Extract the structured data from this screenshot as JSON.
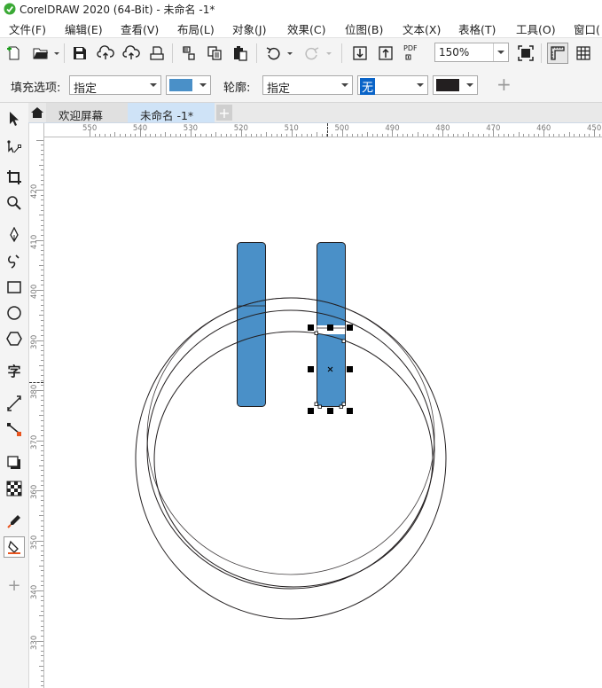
{
  "window": {
    "title": "CorelDRAW 2020 (64-Bit) - 未命名 -1*"
  },
  "menu": [
    "文件(F)",
    "编辑(E)",
    "查看(V)",
    "布局(L)",
    "对象(J)",
    "效果(C)",
    "位图(B)",
    "文本(X)",
    "表格(T)",
    "工具(O)",
    "窗口("
  ],
  "toolbar": {
    "zoom": "150%",
    "pdf_label": "PDF"
  },
  "property_bar": {
    "fill_label": "填充选项:",
    "fill_mode": "指定",
    "fill_color": "#4A90C8",
    "outline_label": "轮廓:",
    "outline_mode": "指定",
    "outline_width": "无",
    "outline_color": "#231F20",
    "add_symbol": "+"
  },
  "tabs": {
    "welcome": "欢迎屏幕",
    "document": "未命名 -1*",
    "add": "+"
  },
  "rulers": {
    "horizontal": [
      "550",
      "540",
      "530",
      "520",
      "510",
      "500",
      "490",
      "480",
      "470",
      "460",
      "450"
    ],
    "vertical": [
      "420",
      "410",
      "400",
      "390",
      "380",
      "370",
      "360",
      "350",
      "340",
      "330"
    ]
  },
  "toolbox_add": "+",
  "colors": {
    "shape_fill": "#4A90C8",
    "outline": "#231F20",
    "active_tab": "#CFE3F7"
  }
}
